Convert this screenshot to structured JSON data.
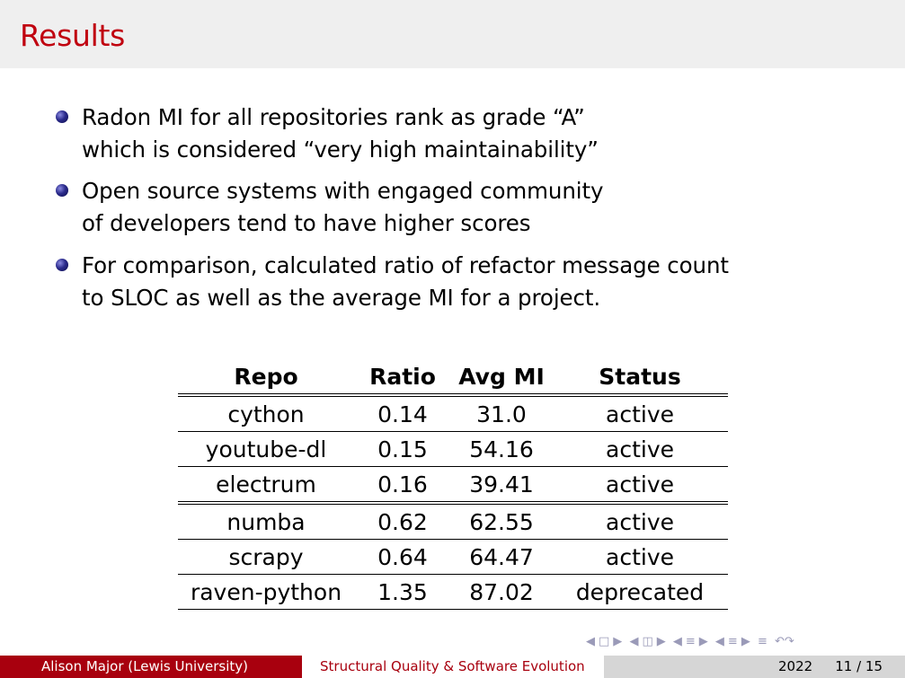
{
  "slide": {
    "title": "Results"
  },
  "bullets": [
    {
      "lines": [
        "Radon MI for all repositories rank as grade “A”",
        "which is considered “very high maintainability”"
      ]
    },
    {
      "lines": [
        "Open source systems with engaged community",
        "of developers tend to have higher scores"
      ]
    },
    {
      "lines": [
        "For comparison, calculated ratio of refactor message count",
        "to SLOC as well as the average MI for a project."
      ]
    }
  ],
  "table": {
    "headers": [
      "Repo",
      "Ratio",
      "Avg MI",
      "Status"
    ],
    "rows": [
      [
        "cython",
        "0.14",
        "31.0",
        "active"
      ],
      [
        "youtube-dl",
        "0.15",
        "54.16",
        "active"
      ],
      [
        "electrum",
        "0.16",
        "39.41",
        "active"
      ],
      [
        "numba",
        "0.62",
        "62.55",
        "active"
      ],
      [
        "scrapy",
        "0.64",
        "64.47",
        "active"
      ],
      [
        "raven-python",
        "1.35",
        "87.02",
        "deprecated"
      ]
    ]
  },
  "footer": {
    "author": "Alison Major  (Lewis University)",
    "title": "Structural Quality & Software Evolution",
    "year": "2022",
    "page": "11 / 15"
  },
  "colors": {
    "title": "#c0000f",
    "footer_left": "#a8000e",
    "footer_right": "#d6d6d6"
  }
}
